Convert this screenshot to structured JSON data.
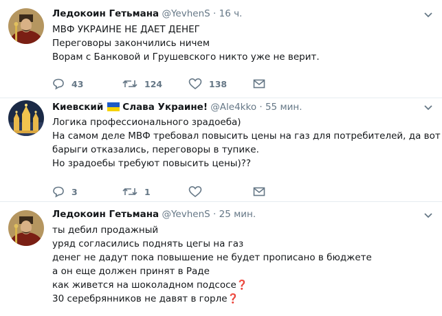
{
  "tweets": [
    {
      "name": "Ледокоин Гетьмана",
      "handle": "@YevhenS",
      "time": "16 ч.",
      "lines": [
        "МВФ УКРАИНЕ НЕ ДАЕТ ДЕНЕГ",
        "Переговоры закончились ничем",
        "Ворам с Банковой и Грушевского никто уже не верит."
      ],
      "replies": "43",
      "retweets": "124",
      "likes": "138"
    },
    {
      "name": "Киевский",
      "name_suffix": "Слава Украине!",
      "handle": "@Ale4kko",
      "time": "55 мин.",
      "lines": [
        "Логика профессионального зрадоеба)",
        "На самом деле МВФ требовал повысить цены на газ для потребителей, да вот",
        "барыги отказались, переговоры в тупике.",
        "Но зрадоебы требуют повысить цены)??"
      ],
      "replies": "3",
      "retweets": "1",
      "likes": ""
    },
    {
      "name": "Ледокоин Гетьмана",
      "handle": "@YevhenS",
      "time": "25 мин.",
      "lines": [
        "ты дебил продажный",
        "уряд соглаcились поднять цегы на газ",
        "денег не дадут пока повышение не будет прописано в бюджете",
        "а он еще должен принят в Раде",
        "как живется на шоколадном подсосе❓",
        "30 серебрянников не давят в горле❓"
      ]
    }
  ],
  "dot": "·",
  "icons": {
    "reply": "reply-icon",
    "retweet": "retweet-icon",
    "like": "heart-icon",
    "dm": "envelope-icon",
    "caret": "chevron-down-icon"
  },
  "colors": {
    "name": "#14171a",
    "secondary": "#657786",
    "flag_blue": "#1e5bc6",
    "flag_yellow": "#f5d200"
  }
}
